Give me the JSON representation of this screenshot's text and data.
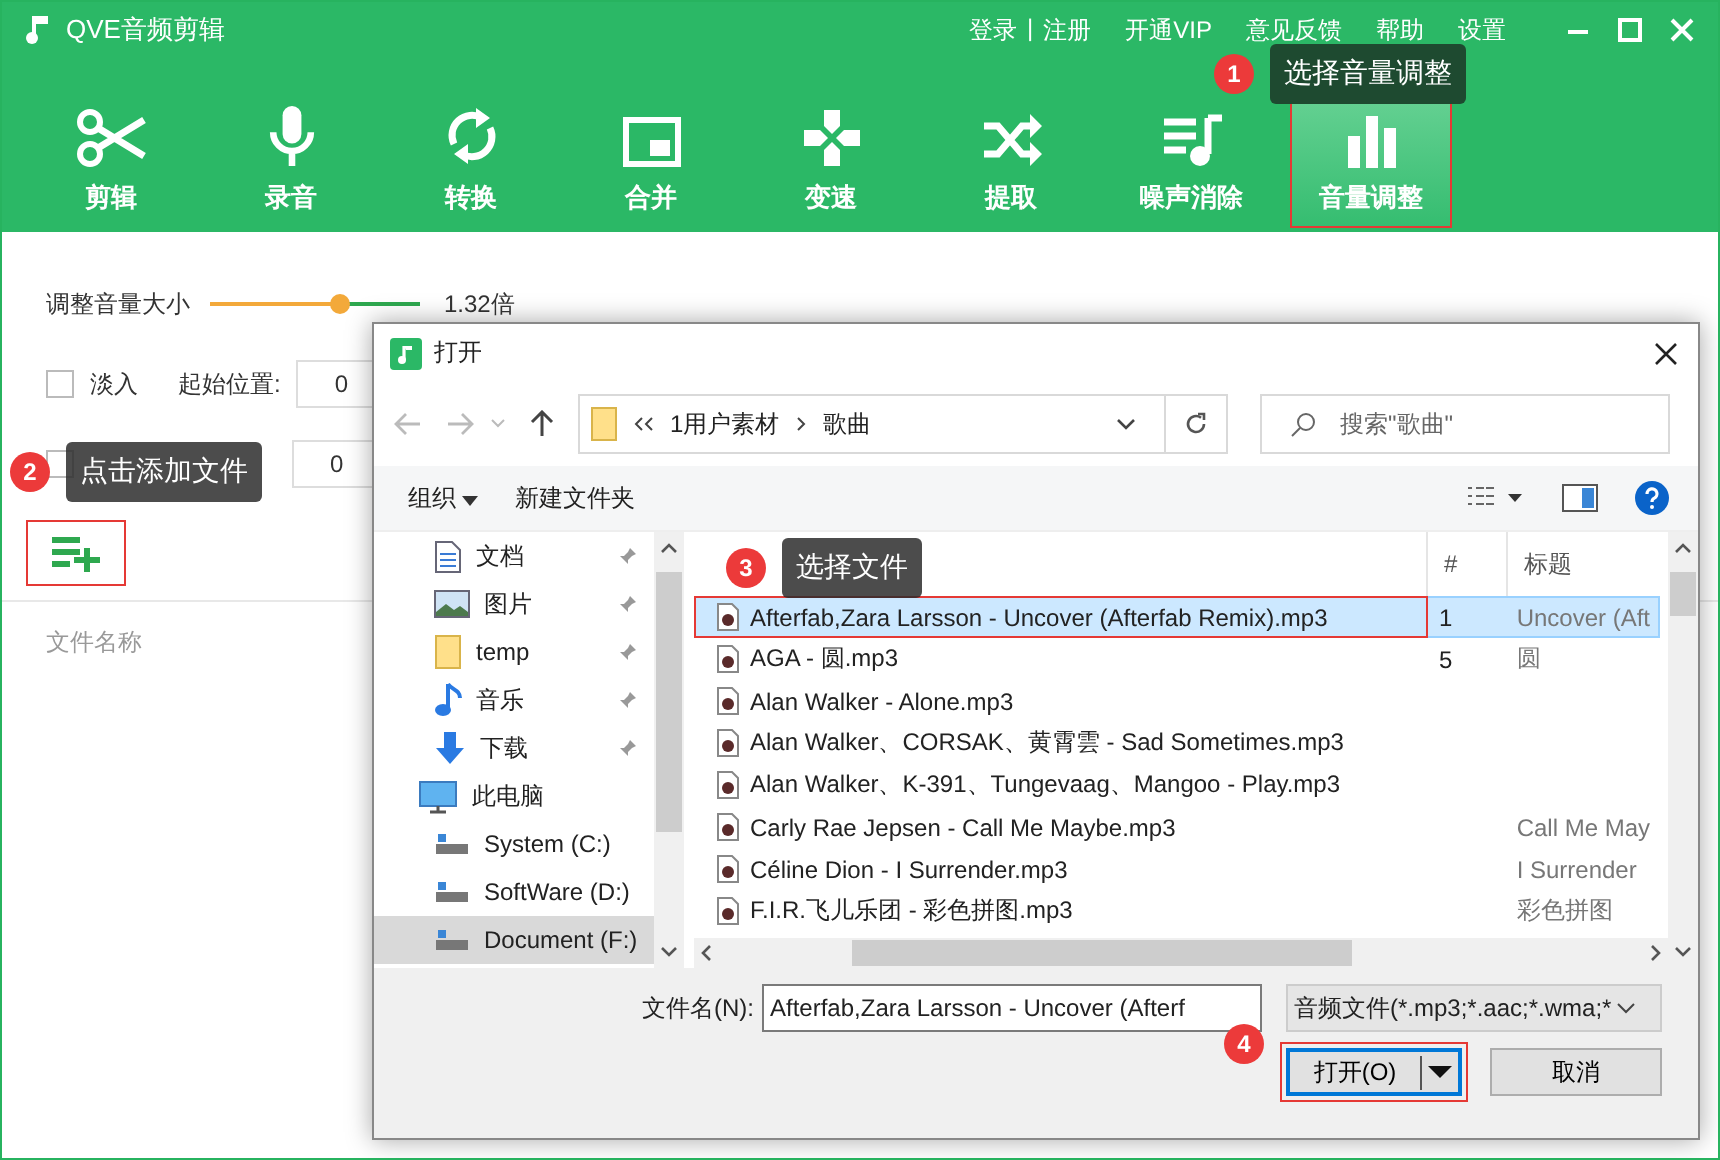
{
  "app": {
    "title": "QVE音频剪辑",
    "separator": "|",
    "links": [
      {
        "label": "登录"
      },
      {
        "label": "注册"
      },
      {
        "label": "开通VIP"
      },
      {
        "label": "意见反馈"
      },
      {
        "label": "帮助"
      },
      {
        "label": "设置"
      }
    ]
  },
  "toolbar": [
    {
      "kind": "scissors",
      "label": "剪辑",
      "selected": false,
      "highlighted": false
    },
    {
      "kind": "mic",
      "label": "录音",
      "selected": false,
      "highlighted": false
    },
    {
      "kind": "sync",
      "label": "转换",
      "selected": false,
      "highlighted": false
    },
    {
      "kind": "merge",
      "label": "合并",
      "selected": false,
      "highlighted": false
    },
    {
      "kind": "dpad",
      "label": "变速",
      "selected": false,
      "highlighted": false
    },
    {
      "kind": "shuffle",
      "label": "提取",
      "selected": false,
      "highlighted": false
    },
    {
      "kind": "denoise",
      "label": "噪声消除",
      "selected": false,
      "highlighted": false
    },
    {
      "kind": "bars",
      "label": "音量调整",
      "selected": true,
      "highlighted": true
    }
  ],
  "volume": {
    "label": "调整音量大小",
    "level": 0.62,
    "reading": "1.32倍"
  },
  "fade_in": {
    "checked": false,
    "label": "淡入",
    "start_label": "起始位置:",
    "value": "0"
  },
  "fade_out": {
    "checked": false,
    "value": "0"
  },
  "add_button": {
    "highlighted": true
  },
  "file_list": {
    "header": "文件名称"
  },
  "dialog": {
    "title": "打开",
    "path": [
      "1用户素材",
      "歌曲"
    ],
    "search_placeholder": "搜索\"歌曲\"",
    "organize": "组织",
    "new_folder": "新建文件夹",
    "nav": [
      {
        "kind": "doc",
        "label": "文档",
        "pinned": true,
        "selected": false
      },
      {
        "kind": "image",
        "label": "图片",
        "pinned": true,
        "selected": false
      },
      {
        "kind": "folder",
        "label": "temp",
        "pinned": true,
        "selected": false
      },
      {
        "kind": "music",
        "label": "音乐",
        "pinned": true,
        "selected": false
      },
      {
        "kind": "download",
        "label": "下载",
        "pinned": true,
        "selected": false
      },
      {
        "kind": "pc",
        "label": "此电脑",
        "selected": false,
        "children": [
          {
            "kind": "drive",
            "label": "System (C:)",
            "selected": false
          },
          {
            "kind": "drive",
            "label": "SoftWare (D:)",
            "selected": false
          },
          {
            "kind": "drive",
            "label": "Document (F:)",
            "selected": true
          }
        ]
      }
    ],
    "columns": [
      {
        "label": "#"
      },
      {
        "label": "标题"
      }
    ],
    "files": [
      {
        "name": "Afterfab,Zara Larsson - Uncover (Afterfab Remix).mp3",
        "number": "1",
        "title": "Uncover (Aft",
        "selected": true,
        "highlighted": true
      },
      {
        "name": "AGA - 圆.mp3",
        "number": "5",
        "title": "圆",
        "selected": false,
        "highlighted": false
      },
      {
        "name": "Alan Walker - Alone.mp3",
        "selected": false,
        "highlighted": false
      },
      {
        "name": "Alan Walker、CORSAK、黄霄雲 - Sad Sometimes.mp3",
        "selected": false,
        "highlighted": false
      },
      {
        "name": "Alan Walker、K-391、Tungevaag、Mangoo - Play.mp3",
        "selected": false,
        "highlighted": false
      },
      {
        "name": "Carly Rae Jepsen - Call Me Maybe.mp3",
        "title": "Call Me May",
        "selected": false,
        "highlighted": false
      },
      {
        "name": "Céline Dion - I Surrender.mp3",
        "title": "I Surrender",
        "selected": false,
        "highlighted": false
      },
      {
        "name": "F.I.R.飞儿乐团 - 彩色拼图.mp3",
        "title": "彩色拼图",
        "selected": false,
        "highlighted": false
      }
    ],
    "filename_label": "文件名(N):",
    "filename_value": "Afterfab,Zara Larsson - Uncover (Afterf",
    "filter": "音频文件(*.mp3;*.aac;*.wma;*",
    "open_button": {
      "label": "打开(O)",
      "highlighted": true
    },
    "cancel_button": "取消"
  },
  "annotations": [
    {
      "number": "1",
      "text": "选择音量调整"
    },
    {
      "number": "2",
      "text": "点击添加文件"
    },
    {
      "number": "3",
      "text": "选择文件"
    },
    {
      "number": "4"
    }
  ]
}
